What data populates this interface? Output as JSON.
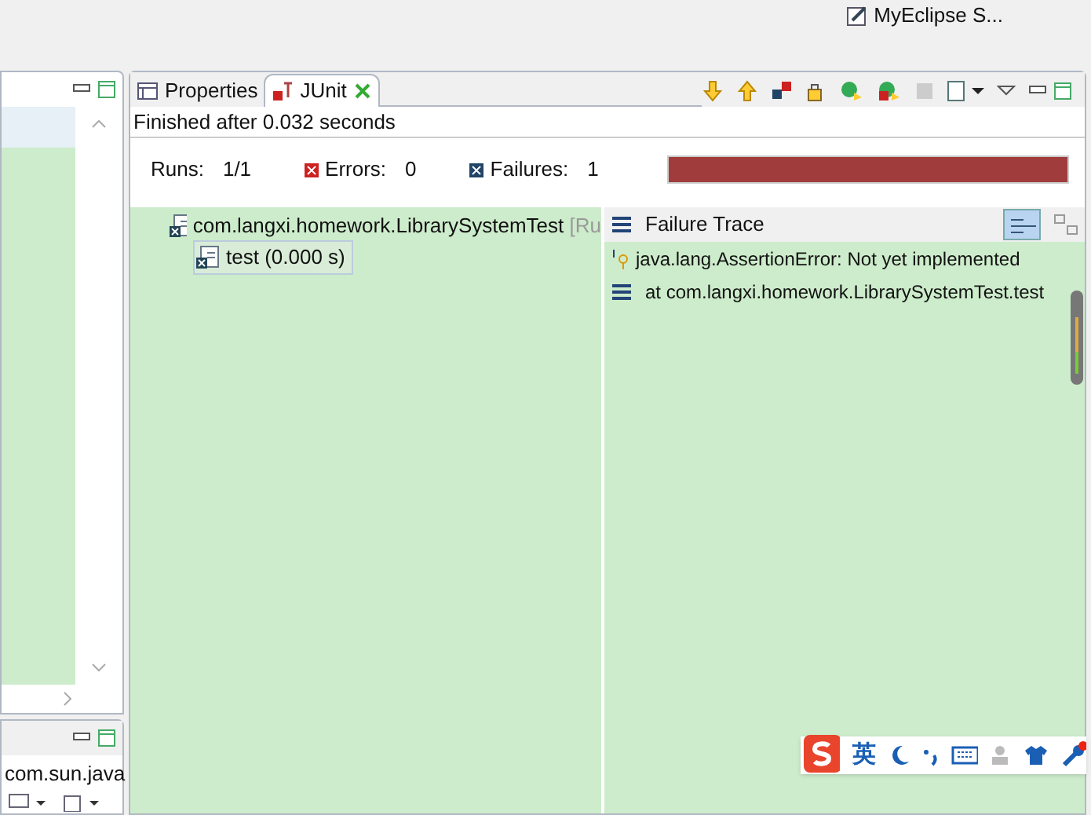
{
  "perspective_switcher": {
    "label": "MyEclipse S..."
  },
  "left_view": {
    "row_tail": "com.sun.java"
  },
  "junit_view": {
    "tabs": [
      {
        "label": "Properties",
        "selected": false
      },
      {
        "label": "JUnit",
        "selected": true
      }
    ],
    "status": "Finished after 0.032 seconds",
    "counters": [
      {
        "kind": "runs",
        "label": "Runs:",
        "value": "1/1"
      },
      {
        "kind": "errors",
        "label": "Errors:",
        "value": "0"
      },
      {
        "kind": "failures",
        "label": "Failures:",
        "value": "1"
      }
    ],
    "progress": {
      "level": 1,
      "failed": true
    },
    "tree": [
      {
        "label": "com.langxi.homework.LibrarySystemTest",
        "suffix": "[Ru",
        "children": [
          {
            "label": "test (0.000 s)",
            "selected": true
          }
        ]
      }
    ],
    "failure_trace": {
      "title": "Failure Trace",
      "filter_on": true,
      "lines": [
        {
          "kind": "error",
          "text": "java.lang.AssertionError: Not yet implemented"
        },
        {
          "kind": "frame",
          "text": "at com.langxi.homework.LibrarySystemTest.test"
        }
      ]
    }
  },
  "ime_bar": {
    "mode": "英"
  }
}
